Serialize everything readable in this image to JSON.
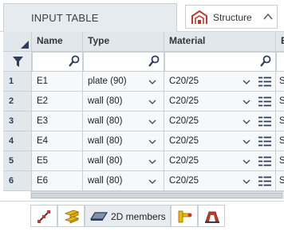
{
  "header": {
    "input_table_label": "INPUT TABLE",
    "structure_label": "Structure"
  },
  "table": {
    "columns": [
      "Name",
      "Type",
      "Material",
      "E"
    ],
    "rows": [
      {
        "num": "1",
        "name": "E1",
        "type": "plate (90)",
        "material": "C20/25",
        "extra": "S"
      },
      {
        "num": "2",
        "name": "E2",
        "type": "wall (80)",
        "material": "C20/25",
        "extra": "S"
      },
      {
        "num": "3",
        "name": "E3",
        "type": "wall (80)",
        "material": "C20/25",
        "extra": "S"
      },
      {
        "num": "4",
        "name": "E4",
        "type": "wall (80)",
        "material": "C20/25",
        "extra": "S"
      },
      {
        "num": "5",
        "name": "E5",
        "type": "wall (80)",
        "material": "C20/25",
        "extra": "S"
      },
      {
        "num": "6",
        "name": "E6",
        "type": "wall (80)",
        "material": "C20/25",
        "extra": "S"
      }
    ]
  },
  "toolbar": {
    "members_2d_label": "2D members"
  },
  "colors": {
    "accent_red": "#c0392b",
    "accent_yellow": "#f2b800",
    "header_gray": "#e2e7ec",
    "icon_dark": "#2c3e5c"
  }
}
